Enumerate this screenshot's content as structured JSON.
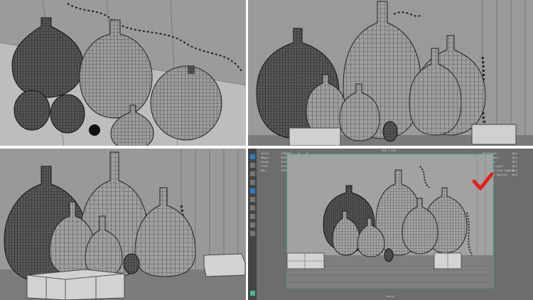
{
  "panels": [
    {
      "name": "viewport-top-left-perspective"
    },
    {
      "name": "viewport-top-right-front"
    },
    {
      "name": "viewport-bottom-left-angle"
    },
    {
      "name": "viewport-bottom-right-render-view"
    }
  ],
  "render_view": {
    "resolution_label": "960 x 540",
    "footer_label": "persp",
    "hud_left": [
      {
        "label": "Verts:",
        "v1": "1356493",
        "v2": "0",
        "v3": "0"
      },
      {
        "label": "Edges:",
        "v1": "2645881",
        "v2": "0",
        "v3": "0"
      },
      {
        "label": "Faces:",
        "v1": "1273102",
        "v2": "0",
        "v3": "0"
      },
      {
        "label": "Tris:",
        "v1": "2531988",
        "v2": "0",
        "v3": "0"
      },
      {
        "label": "UVs:",
        "v1": "1492817",
        "v2": "0",
        "v3": "0"
      }
    ],
    "hud_right": [
      {
        "label": "Backfaces:",
        "value": "N/A"
      },
      {
        "label": "Smoothness:",
        "value": "N/A"
      },
      {
        "label": "Instance:",
        "value": "N/A"
      },
      {
        "label": "Display Layer:",
        "value": "N/A"
      },
      {
        "label": "Distance From Camera:",
        "value": "N/A"
      },
      {
        "label": "Selected Objects:",
        "value": "N/A"
      }
    ],
    "checkmark_color": "#e02020"
  },
  "colors": {
    "viewport_bg": "#8a8a8a",
    "wire": "#1e1e1e",
    "wall": "#9a9a9a",
    "floor": "#7a7a7a",
    "ui_dark": "#444444",
    "accent_green": "#49b88a"
  }
}
